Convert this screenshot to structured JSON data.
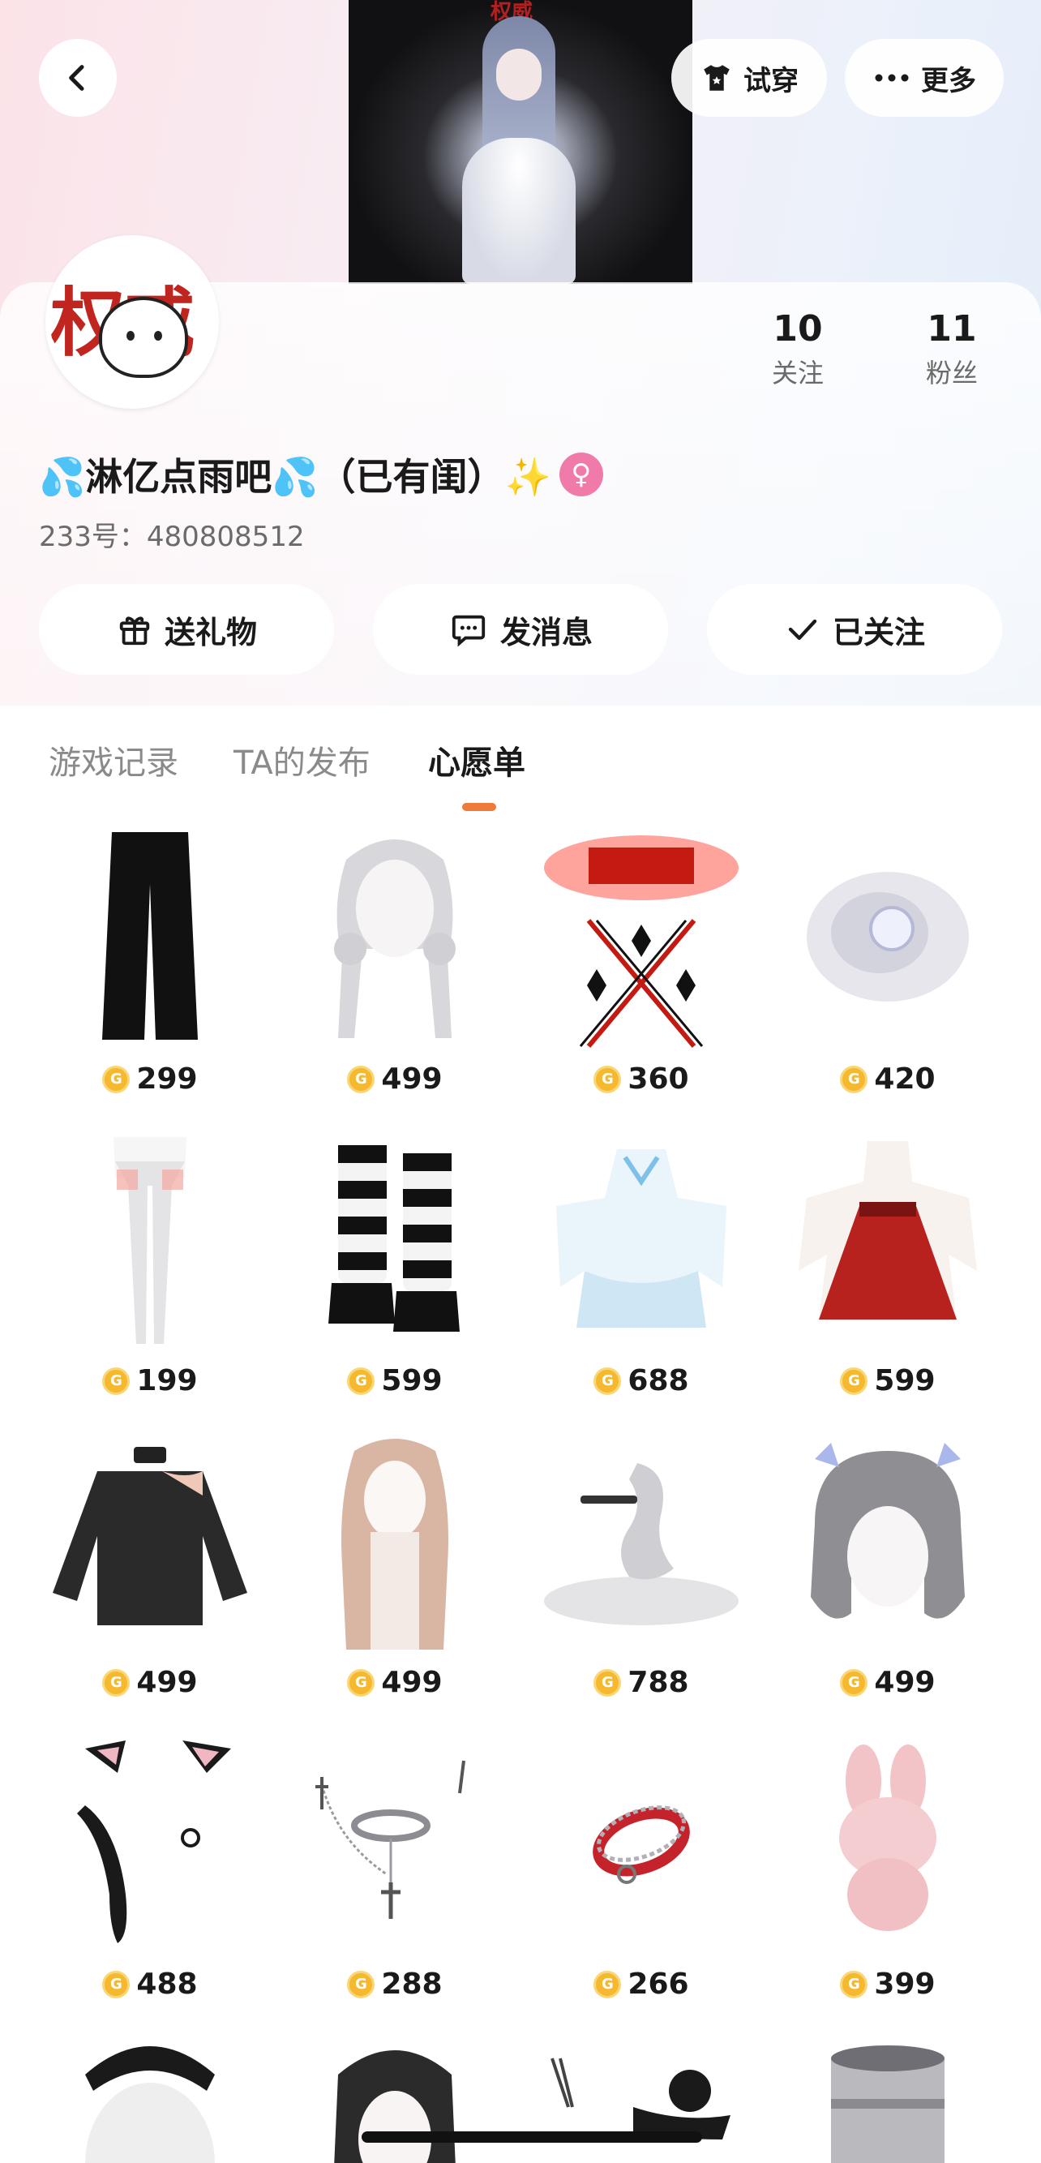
{
  "header": {
    "try_on_label": "试穿",
    "more_label": "更多",
    "cover_text": "权威"
  },
  "profile": {
    "avatar_text": "权威",
    "follow_count": "10",
    "follow_label": "关注",
    "fans_count": "11",
    "fans_label": "粉丝",
    "nickname": "💦淋亿点雨吧💦（已有闺）✨",
    "uid": "233号：480808512"
  },
  "actions": {
    "gift_label": "送礼物",
    "message_label": "发消息",
    "followed_label": "已关注"
  },
  "tabs": [
    {
      "label": "游戏记录",
      "active": false
    },
    {
      "label": "TA的发布",
      "active": false
    },
    {
      "label": "心愿单",
      "active": true
    }
  ],
  "wishlist": [
    {
      "item": "black-wide-pants",
      "price": "299"
    },
    {
      "item": "silver-twin-tail-hair",
      "price": "499"
    },
    {
      "item": "red-authority-emblem",
      "price": "360"
    },
    {
      "item": "misty-aura-effect",
      "price": "420"
    },
    {
      "item": "white-stockings",
      "price": "199"
    },
    {
      "item": "striped-leg-warmers-boots",
      "price": "599"
    },
    {
      "item": "blue-frilly-dress",
      "price": "688"
    },
    {
      "item": "red-lolita-dress",
      "price": "599"
    },
    {
      "item": "black-knit-sweater",
      "price": "499"
    },
    {
      "item": "long-peach-hair",
      "price": "499"
    },
    {
      "item": "silver-dragon-effect",
      "price": "788"
    },
    {
      "item": "grey-bob-hair",
      "price": "499"
    },
    {
      "item": "cat-ears-and-tail",
      "price": "488"
    },
    {
      "item": "silver-choker-chain",
      "price": "288"
    },
    {
      "item": "red-spiked-bracelet",
      "price": "266"
    },
    {
      "item": "pink-bunny-plush",
      "price": "399"
    }
  ],
  "colors": {
    "accent": "#f07a3a",
    "coin": "#f5b82e",
    "gender_female": "#f07bab"
  }
}
